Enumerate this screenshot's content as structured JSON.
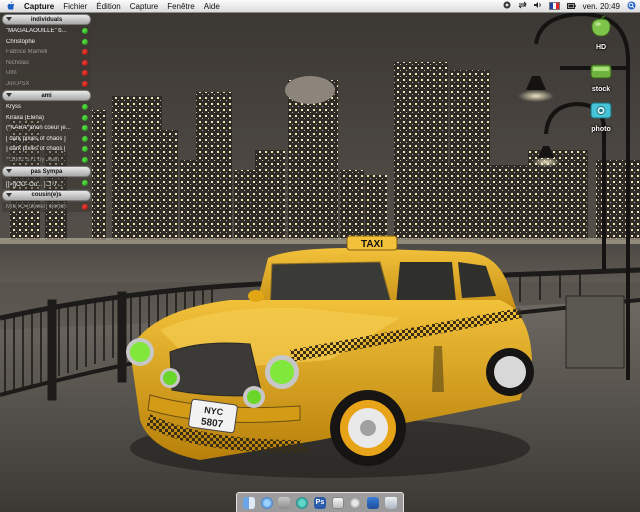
{
  "menubar": {
    "app_name": "Capture",
    "menus": [
      "Fichier",
      "Édition",
      "Capture",
      "Fenêtre",
      "Aide"
    ],
    "clock": "ven. 20:49"
  },
  "buddy_list": {
    "groups": [
      {
        "title": "individuals",
        "contacts": [
          {
            "name": "\"MAGALAOUILLE\"    b...",
            "status": "online"
          },
          {
            "name": "Christophe",
            "status": "online"
          },
          {
            "name": "Fabrice Marrelli",
            "status": "offline"
          },
          {
            "name": "Nicholas",
            "status": "offline"
          },
          {
            "name": "Ulm",
            "status": "offline"
          },
          {
            "name": "Jon.PSX",
            "status": "offline"
          }
        ]
      },
      {
        "title": "ami",
        "contacts": [
          {
            "name": "Kryss",
            "status": "online"
          },
          {
            "name": "Kiraxa (Elena)",
            "status": "online"
          },
          {
            "name": "(*KARA*)mon coeur je...",
            "status": "online"
          },
          {
            "name": "[ dark pixies of chaos ]",
            "status": "online"
          },
          {
            "name": "] dark pixies of chaos [",
            "status": "online"
          },
          {
            "name": "**1002 S71 by Jean",
            "status": "online"
          }
        ]
      },
      {
        "title": "pas Sympa",
        "contacts": [
          {
            "name": "[[>]]OO- Oo...  ]コリ...",
            "status": "online"
          }
        ]
      },
      {
        "title": "cousin(e)s",
        "contacts": [
          {
            "name": "MISTO (Olivier) Bertch",
            "status": "offline"
          }
        ]
      }
    ]
  },
  "desktop_icons": [
    {
      "label": "HD",
      "icon": "hard-drive-icon"
    },
    {
      "label": "stock",
      "icon": "green-drive-icon"
    },
    {
      "label": "photo",
      "icon": "photo-drive-icon"
    }
  ],
  "wallpaper": {
    "taxi_roof_sign": "TAXI",
    "license_plate_line1": "NYC",
    "license_plate_line2": "5807"
  },
  "dock": {
    "items": [
      "finder-icon",
      "safari-icon",
      "mail-icon",
      "itunes-icon",
      "photoshop-icon",
      "preview-icon",
      "system-prefs-icon",
      "terminal-icon",
      "trash-icon"
    ],
    "photoshop_label": "Ps"
  },
  "colors": {
    "taxi_yellow": "#e0a614",
    "online": "#4cd43a",
    "offline": "#e5322b",
    "headlight_green": "#7fe83a"
  }
}
